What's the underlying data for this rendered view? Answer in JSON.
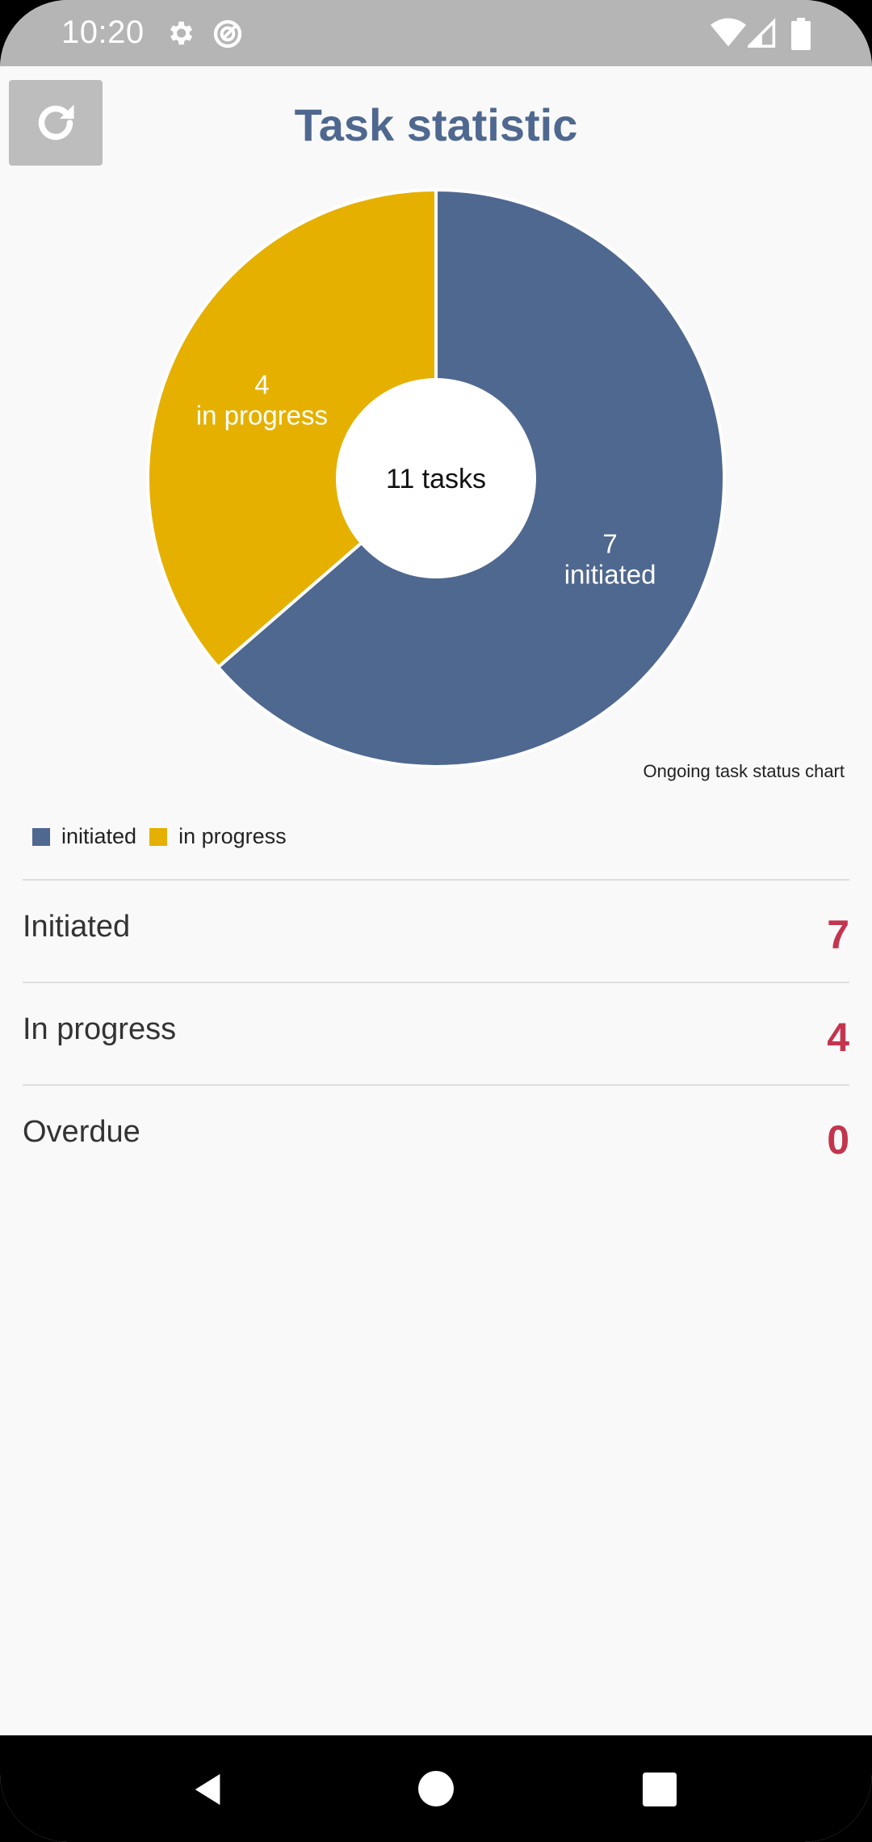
{
  "status_bar": {
    "time": "10:20",
    "icons": [
      "settings-gear-icon",
      "data-saver-icon",
      "wifi-icon",
      "cell-signal-icon",
      "battery-icon"
    ]
  },
  "header": {
    "title": "Task statistic",
    "refresh_icon": "refresh-icon"
  },
  "chart_data": {
    "type": "pie",
    "categories": [
      "initiated",
      "in progress"
    ],
    "values": [
      7,
      4
    ],
    "colors": [
      "#4f6890",
      "#e5b000"
    ],
    "center_label": "11 tasks",
    "slice_labels": [
      {
        "count": "7",
        "name": "initiated"
      },
      {
        "count": "4",
        "name": "in progress"
      }
    ],
    "title": "Ongoing task status chart",
    "legend": [
      "initiated",
      "in progress"
    ],
    "legend_position": "bottom-left"
  },
  "stats": [
    {
      "label": "Initiated",
      "value": "7"
    },
    {
      "label": "In progress",
      "value": "4"
    },
    {
      "label": "Overdue",
      "value": "0"
    }
  ],
  "nav_bar": {
    "icons": [
      "back-icon",
      "home-icon",
      "recents-icon"
    ]
  },
  "colors": {
    "accent": "#4f6890",
    "secondary": "#e5b000",
    "value": "#c3354f",
    "status_bar": "#b5b5b5",
    "background": "#f9f9f9"
  }
}
